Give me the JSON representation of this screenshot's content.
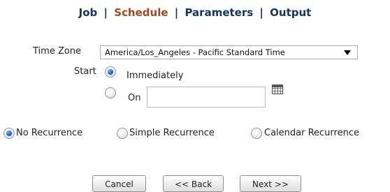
{
  "nav": {
    "tabs": [
      {
        "label": "Job",
        "active": false
      },
      {
        "label": "Schedule",
        "active": true
      },
      {
        "label": "Parameters",
        "active": false
      },
      {
        "label": "Output",
        "active": false
      }
    ],
    "separator": "|"
  },
  "form": {
    "timezone_label": "Time Zone",
    "timezone_value": "America/Los_Angeles - Pacific Standard Time",
    "start_label": "Start",
    "start_options": [
      {
        "label": "Immediately",
        "checked": true
      },
      {
        "label": "On",
        "checked": false
      }
    ],
    "on_date_value": "",
    "calendar_icon": "calendar-icon"
  },
  "recurrence": {
    "options": [
      {
        "label": "No Recurrence",
        "checked": true
      },
      {
        "label": "Simple Recurrence",
        "checked": false
      },
      {
        "label": "Calendar Recurrence",
        "checked": false
      }
    ]
  },
  "buttons": {
    "cancel": "Cancel",
    "back": "<< Back",
    "next": "Next >>"
  },
  "colors": {
    "nav_text": "#13356a",
    "nav_active": "#a5481a"
  }
}
